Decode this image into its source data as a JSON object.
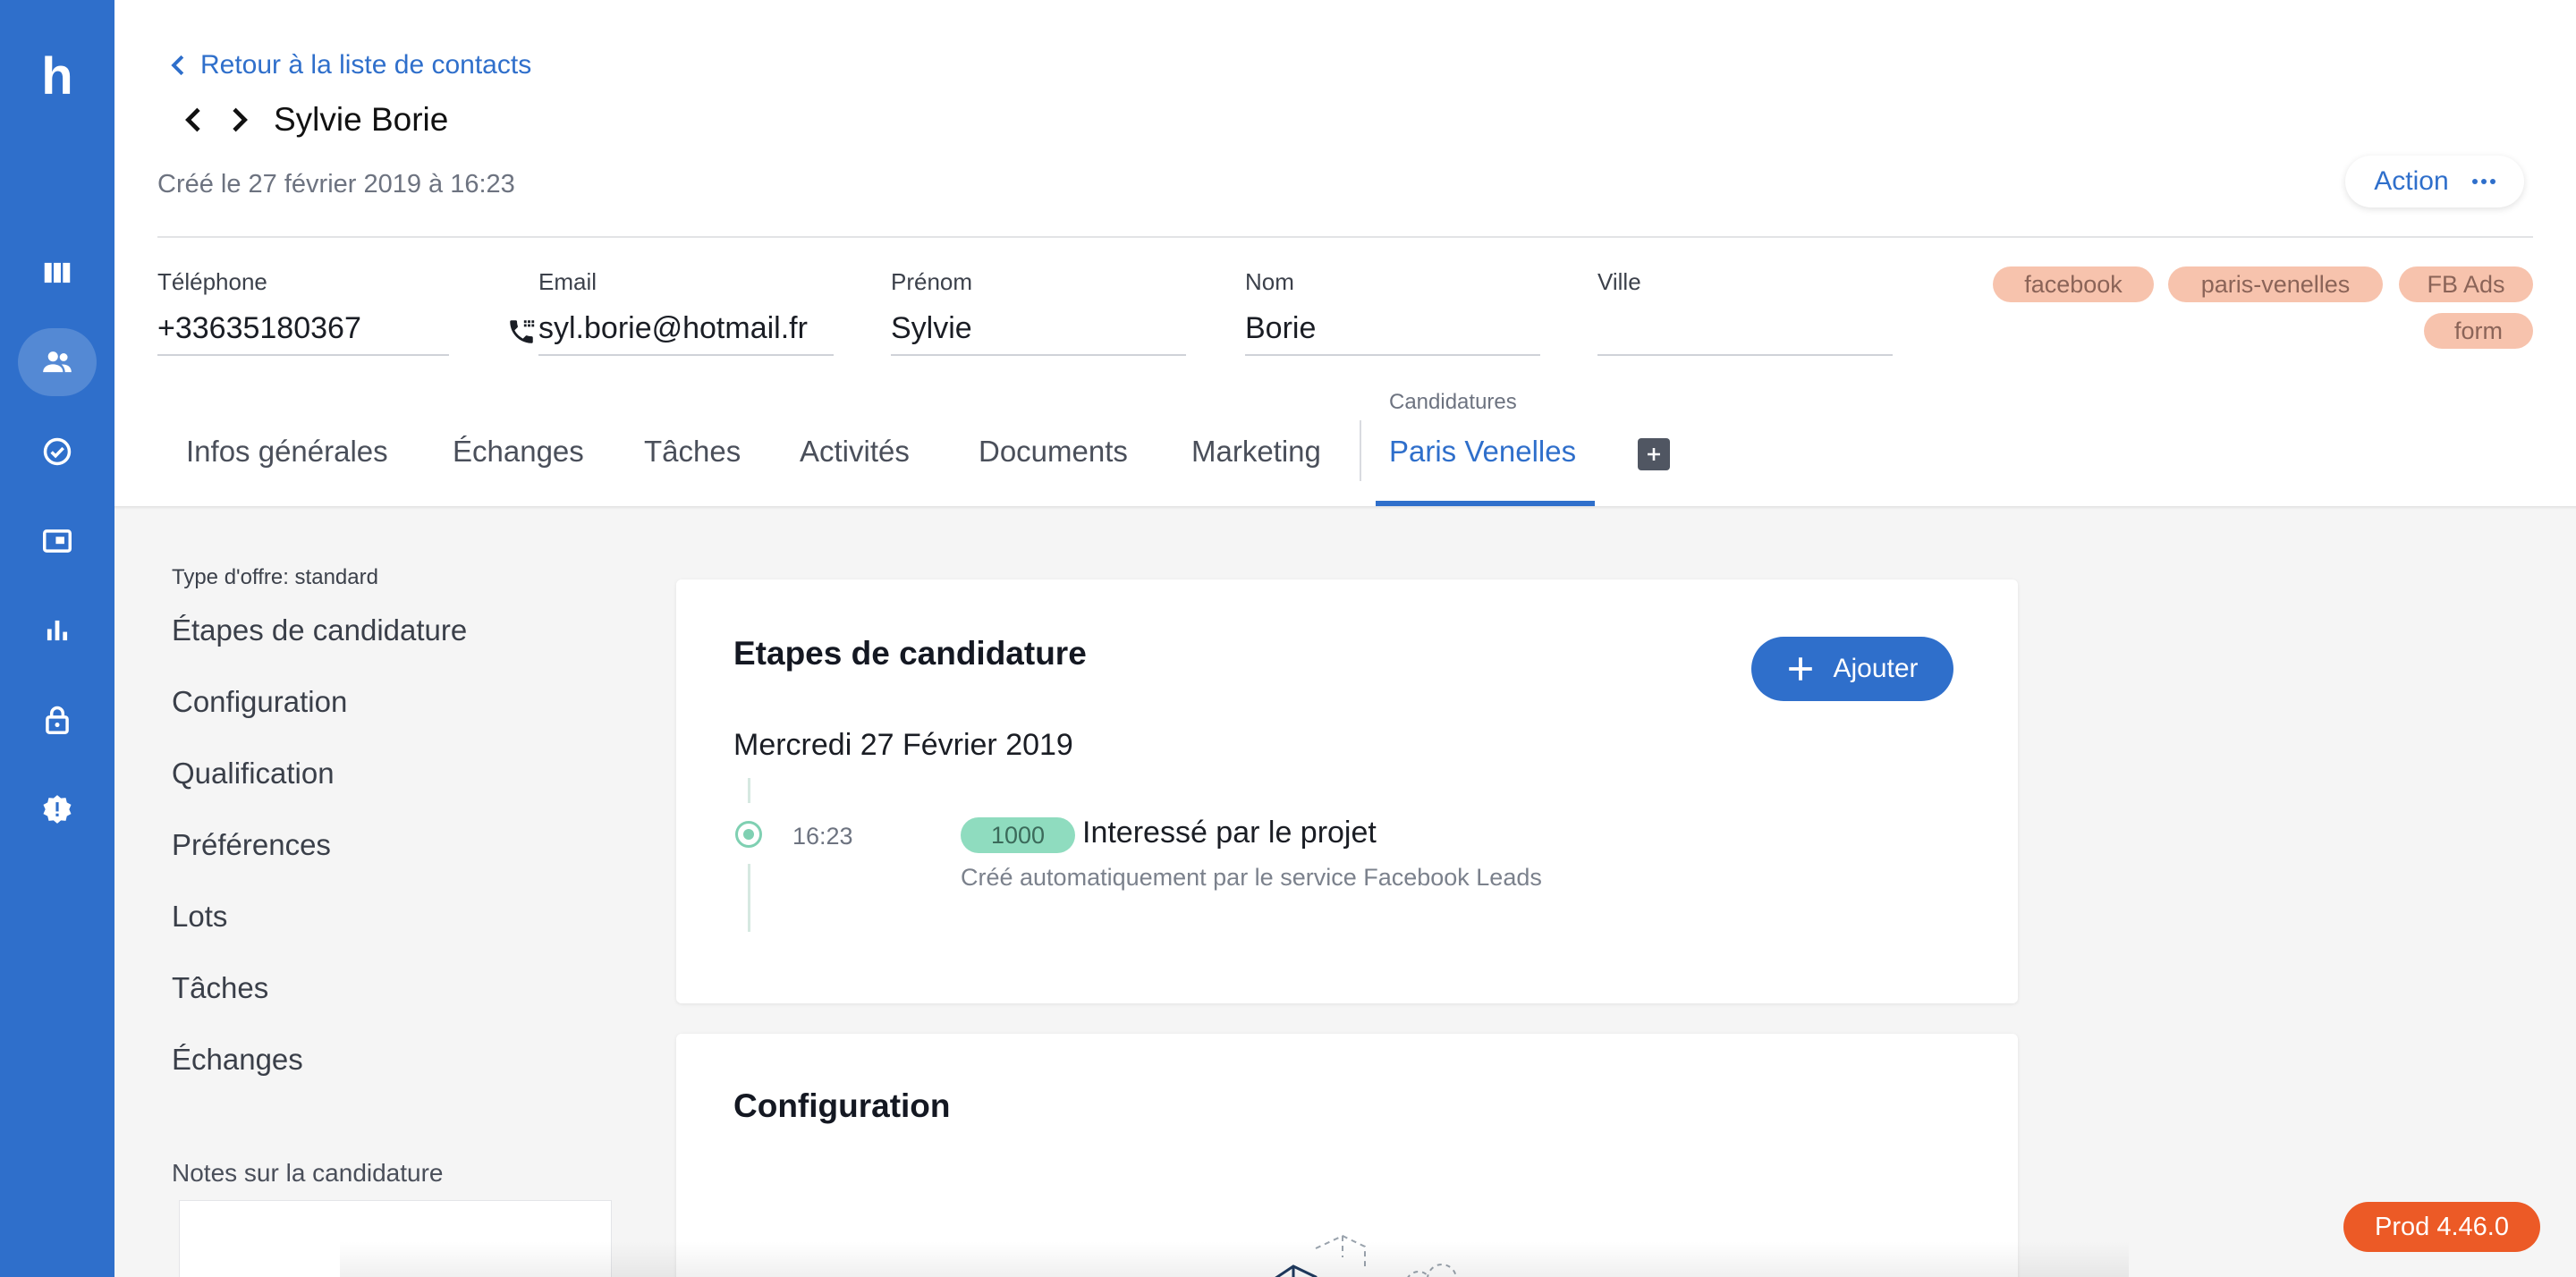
{
  "app": {
    "logo_letter": "h"
  },
  "sidebar": {
    "items": [
      {
        "icon": "board-icon"
      },
      {
        "icon": "contacts-icon",
        "active": true
      },
      {
        "icon": "check-circle-icon"
      },
      {
        "icon": "card-icon"
      },
      {
        "icon": "bar-chart-icon"
      },
      {
        "icon": "lock-icon"
      },
      {
        "icon": "alert-badge-icon"
      }
    ]
  },
  "header": {
    "back_link": "Retour à la liste de contacts",
    "contact_name": "Sylvie Borie",
    "created": "Créé le 27 février 2019 à 16:23",
    "action_label": "Action"
  },
  "fields": {
    "phone": {
      "label": "Téléphone",
      "value": "+33635180367"
    },
    "email": {
      "label": "Email",
      "value": "syl.borie@hotmail.fr"
    },
    "firstname": {
      "label": "Prénom",
      "value": "Sylvie"
    },
    "lastname": {
      "label": "Nom",
      "value": "Borie"
    },
    "city": {
      "label": "Ville",
      "value": ""
    }
  },
  "tags": [
    "facebook",
    "paris-venelles",
    "FB Ads",
    "form"
  ],
  "tabs": {
    "items": [
      "Infos générales",
      "Échanges",
      "Tâches",
      "Activités",
      "Documents",
      "Marketing"
    ],
    "candidatures_label": "Candidatures",
    "active": "Paris Venelles"
  },
  "left_menu": {
    "offer_type": "Type d'offre: standard",
    "items": [
      "Étapes de candidature",
      "Configuration",
      "Qualification",
      "Préférences",
      "Lots",
      "Tâches",
      "Échanges"
    ],
    "notes_label": "Notes sur la candidature"
  },
  "steps_card": {
    "title": "Etapes de candidature",
    "add_label": "Ajouter",
    "date": "Mercredi 27 Février 2019",
    "entry": {
      "time": "16:23",
      "badge": "1000",
      "title": "Interessé par le projet",
      "subtitle": "Créé automatiquement par le service Facebook Leads"
    }
  },
  "config_card": {
    "title": "Configuration"
  },
  "colors": {
    "primary": "#2f6fcb",
    "tag_bg": "#f7c3ad",
    "badge_green": "#8fdcbf",
    "prod_orange": "#ec5a26"
  },
  "footer": {
    "version": "Prod 4.46.0"
  }
}
